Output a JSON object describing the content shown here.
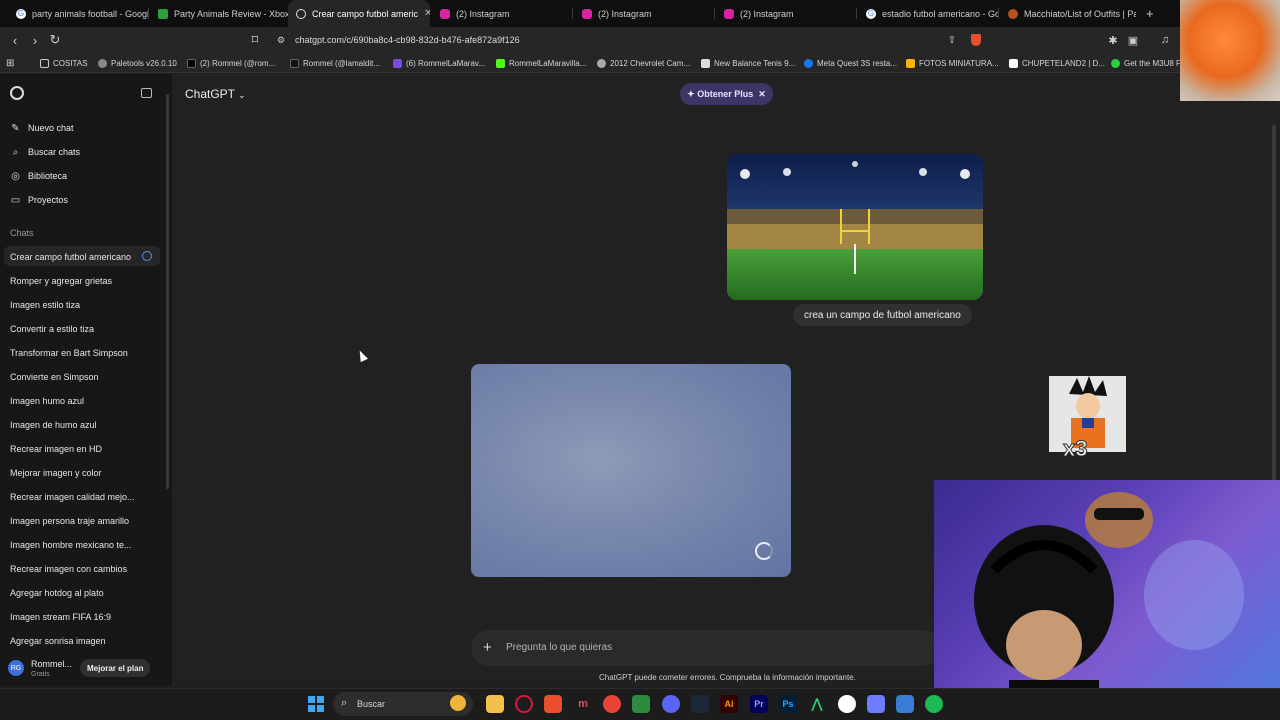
{
  "tabs": [
    {
      "label": "party animals football - Google",
      "icon": "google-icon",
      "active": false
    },
    {
      "label": "Party Animals Review - Xbox Ta",
      "icon": "xbox-icon",
      "active": false
    },
    {
      "label": "Crear campo futbol americ",
      "icon": "chatgpt-icon",
      "active": true
    },
    {
      "label": "(2) Instagram",
      "icon": "instagram-icon",
      "active": false
    },
    {
      "label": "(2) Instagram",
      "icon": "instagram-icon",
      "active": false
    },
    {
      "label": "(2) Instagram",
      "icon": "instagram-icon",
      "active": false
    },
    {
      "label": "estadio futbol americano - Go",
      "icon": "google-icon",
      "active": false
    },
    {
      "label": "Macchiato/List of Outfits | Part",
      "icon": "wiki-icon",
      "active": false
    }
  ],
  "address": {
    "url": "chatgpt.com/c/690ba8c4-cb98-832d-b476-afe872a9f126"
  },
  "bookmarks": [
    "COSITAS",
    "Paletools v26.0.10",
    "(2) Rommel (@rom...",
    "Rommel (@lamaldit...",
    "(6) RommelLaMarav...",
    "RommelLaMaravilla...",
    "2012 Chevrolet Cam...",
    "New Balance Tenis 9...",
    "Meta Quest 3S resta...",
    "FOTOS MINIATURA...",
    "CHUPETELAND2 | D...",
    "Get the M3U8 F"
  ],
  "sidebar": {
    "nav": [
      {
        "label": "Nuevo chat",
        "icon": "edit-icon"
      },
      {
        "label": "Buscar chats",
        "icon": "search-icon"
      },
      {
        "label": "Biblioteca",
        "icon": "library-icon"
      },
      {
        "label": "Proyectos",
        "icon": "folder-icon"
      }
    ],
    "chats_label": "Chats",
    "chats": [
      "Crear campo futbol americano",
      "Romper y agregar grietas",
      "Imagen estilo tiza",
      "Convertir a estilo tiza",
      "Transformar en Bart Simpson",
      "Convierte en Simpson",
      "Imagen humo azul",
      "Imagen de humo azul",
      "Recrear imagen en HD",
      "Mejorar imagen y color",
      "Recrear imagen calidad mejo...",
      "Imagen persona traje amarillo",
      "Imagen hombre mexicano te...",
      "Recrear imagen con cambios",
      "Agregar hotdog al plato",
      "Imagen stream FIFA 16:9",
      "Agregar sonrisa imagen"
    ],
    "user": {
      "initials": "RG",
      "name": "Rommel...",
      "plan": "Gratis",
      "upgrade_label": "Mejorar el plan"
    }
  },
  "header": {
    "model": "ChatGPT",
    "plus_label": "Obtener Plus"
  },
  "conversation": {
    "user_message": "crea un campo de futbol americano"
  },
  "composer": {
    "placeholder": "Pregunta lo que quieras"
  },
  "disclaimer": "ChatGPT puede cometer errores. Comprueba la información importante.",
  "overlay": {
    "sticker_text": "x3"
  },
  "taskbar": {
    "search_label": "Buscar"
  }
}
